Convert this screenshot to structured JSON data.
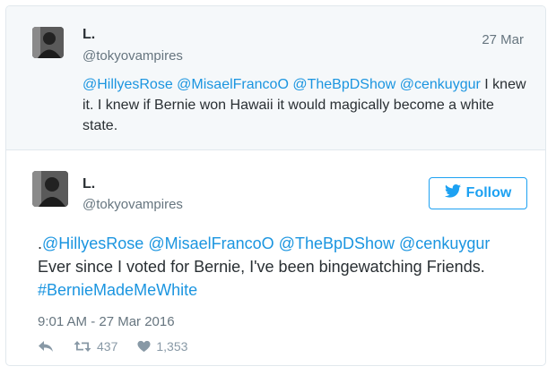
{
  "parent_tweet": {
    "name": "L.",
    "handle": "@tokyovampires",
    "date": "27 Mar",
    "mentions": [
      "@HillyesRose",
      "@MisaelFrancoO",
      "@TheBpDShow",
      "@cenkuygur"
    ],
    "text_rest": "I knew it. I knew if Bernie won Hawaii it would magically become a white state."
  },
  "main_tweet": {
    "name": "L.",
    "handle": "@tokyovampires",
    "follow_label": "Follow",
    "prefix": ".",
    "mentions": [
      "@HillyesRose",
      "@MisaelFrancoO",
      "@TheBpDShow",
      "@cenkuygur"
    ],
    "line2": "Ever since I voted for Bernie, I've been bingewatching Friends.",
    "hashtag": "#BernieMadeMeWhite",
    "timestamp": "9:01 AM - 27 Mar 2016",
    "retweets": "437",
    "likes": "1,353"
  },
  "icons": {
    "follow": "bird-icon",
    "reply": "reply-icon",
    "retweet": "retweet-icon",
    "like": "heart-icon"
  },
  "colors": {
    "link": "#1b95e0",
    "follow": "#1da1f2",
    "muted": "#66757f",
    "action": "#8899a6",
    "parent_bg": "#f5f8fa",
    "border": "#e1e8ed"
  }
}
